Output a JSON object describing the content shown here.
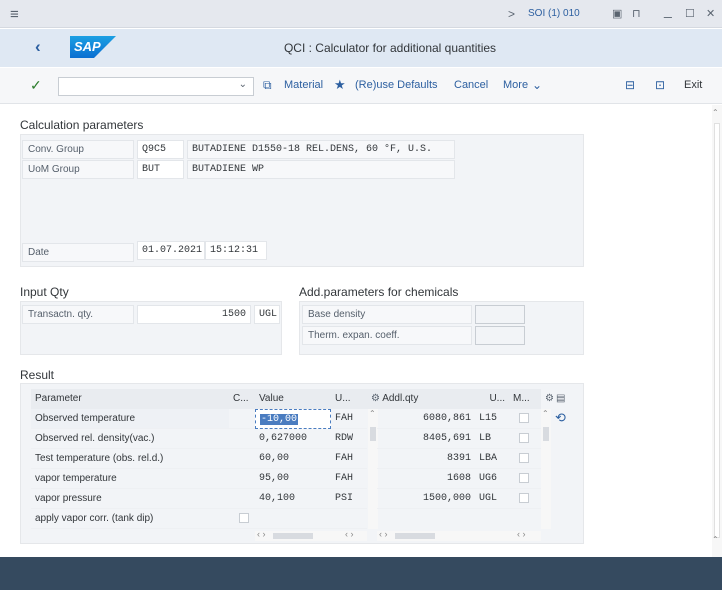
{
  "system": {
    "chevron": ">",
    "system_id": "SOI (1) 010",
    "icons": [
      "screenshot-icon",
      "security-lock-icon",
      "minimize-icon",
      "maximize-icon",
      "close-icon"
    ]
  },
  "title_bar": {
    "logo": "SAP",
    "title": "QCI : Calculator for additional quantities"
  },
  "toolbar": {
    "material": "Material",
    "reuse_defaults": "(Re)use Defaults",
    "cancel": "Cancel",
    "more": "More",
    "exit": "Exit"
  },
  "calc_params": {
    "header": "Calculation parameters",
    "conv_group_label": "Conv. Group",
    "conv_group_value": "Q9C5",
    "conv_group_text": "BUTADIENE D1550-18 REL.DENS, 60 °F, U.S.",
    "uom_group_label": "UoM Group",
    "uom_group_value": "BUT",
    "uom_group_text": "BUTADIENE WP",
    "date_label": "Date",
    "date_value": "01.07.2021",
    "time_value": "15:12:31"
  },
  "input_qty": {
    "header": "Input Qty",
    "transactn_label": "Transactn. qty.",
    "transactn_value": "1500",
    "transactn_unit": "UGL"
  },
  "add_params": {
    "header": "Add.parameters for chemicals",
    "base_density_label": "Base density",
    "therm_label": "Therm. expan. coeff."
  },
  "result": {
    "header": "Result",
    "columns": {
      "parameter": "Parameter",
      "c": "C...",
      "value": "Value",
      "u": "U...",
      "addl_qty": "Addl.qty",
      "u2": "U...",
      "m": "M..."
    },
    "rows": [
      {
        "parameter": "Observed temperature",
        "value": "-10,00",
        "unit": "FAH"
      },
      {
        "parameter": "Observed rel. density(vac.)",
        "value": "0,627000",
        "unit": "RDW"
      },
      {
        "parameter": "Test temperature (obs. rel.d.)",
        "value": "60,00",
        "unit": "FAH"
      },
      {
        "parameter": "vapor temperature",
        "value": "95,00",
        "unit": "FAH"
      },
      {
        "parameter": "vapor pressure",
        "value": "40,100",
        "unit": "PSI"
      },
      {
        "parameter": "apply vapor corr. (tank dip)",
        "value": "",
        "unit": ""
      }
    ],
    "addl_rows": [
      {
        "qty": "6080,861",
        "unit": "L15"
      },
      {
        "qty": "8405,691",
        "unit": "LB"
      },
      {
        "qty": "8391",
        "unit": "LBA"
      },
      {
        "qty": "1608",
        "unit": "UG6"
      },
      {
        "qty": "1500,000",
        "unit": "UGL"
      }
    ]
  }
}
